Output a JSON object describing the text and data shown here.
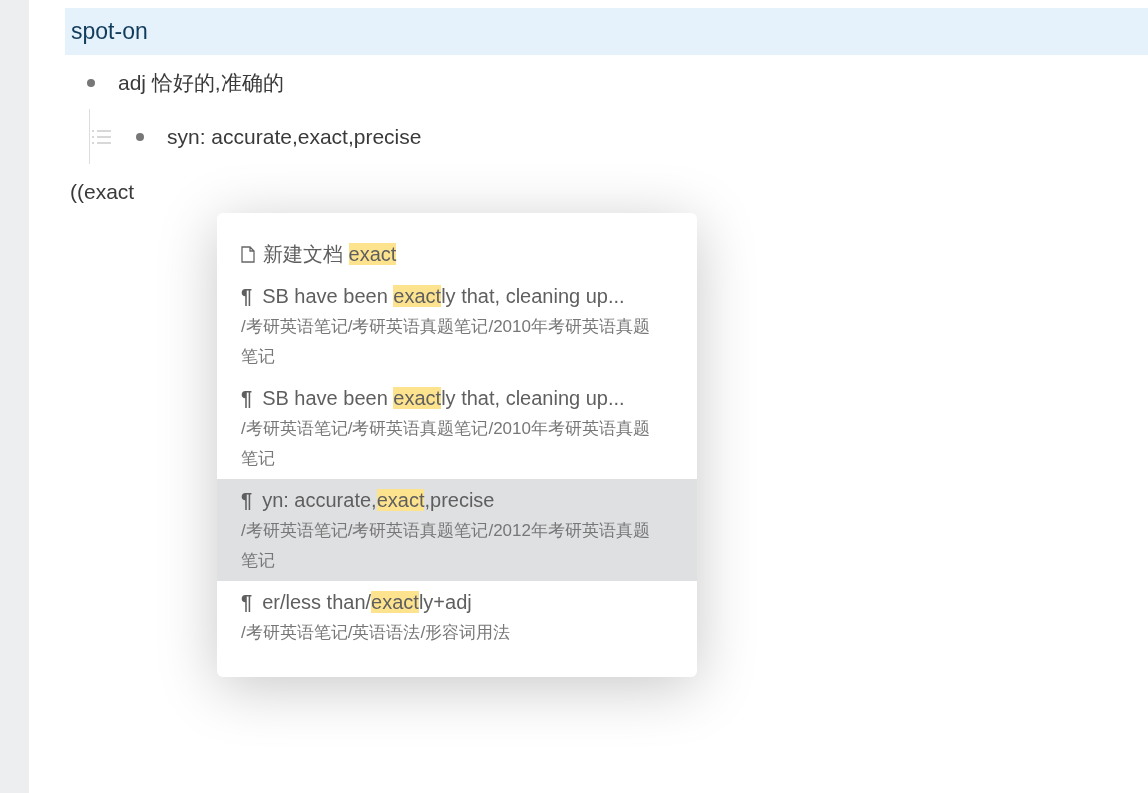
{
  "heading": "spot-on",
  "list": [
    {
      "text": "adj 恰好的,准确的",
      "children": [
        {
          "text": "syn: accurate,exact,precise"
        }
      ]
    }
  ],
  "typed": "((exact",
  "results": [
    {
      "kind": "doc",
      "title": {
        "before": "新建文档 ",
        "match": "exact"
      },
      "selected": false
    },
    {
      "kind": "block",
      "marker": "¶",
      "title": {
        "before": "SB have been ",
        "match": "exact",
        "after": "ly that, cleaning up..."
      },
      "path": "/考研英语笔记/考研英语真题笔记/2010年考研英语真题笔记",
      "selected": false
    },
    {
      "kind": "block",
      "marker": "¶",
      "title": {
        "before": "SB have been ",
        "match": "exact",
        "after": "ly that, cleaning up..."
      },
      "path": "/考研英语笔记/考研英语真题笔记/2010年考研英语真题笔记",
      "selected": false
    },
    {
      "kind": "block",
      "marker": "¶",
      "title": {
        "before": "yn: accurate,",
        "match": "exact",
        "after": ",precise"
      },
      "path": "/考研英语笔记/考研英语真题笔记/2012年考研英语真题笔记",
      "selected": true
    },
    {
      "kind": "block",
      "marker": "¶",
      "title": {
        "before": "er/less than/",
        "match": "exact",
        "after": "ly+adj"
      },
      "path": "/考研英语笔记/英语语法/形容词用法",
      "selected": false
    }
  ]
}
